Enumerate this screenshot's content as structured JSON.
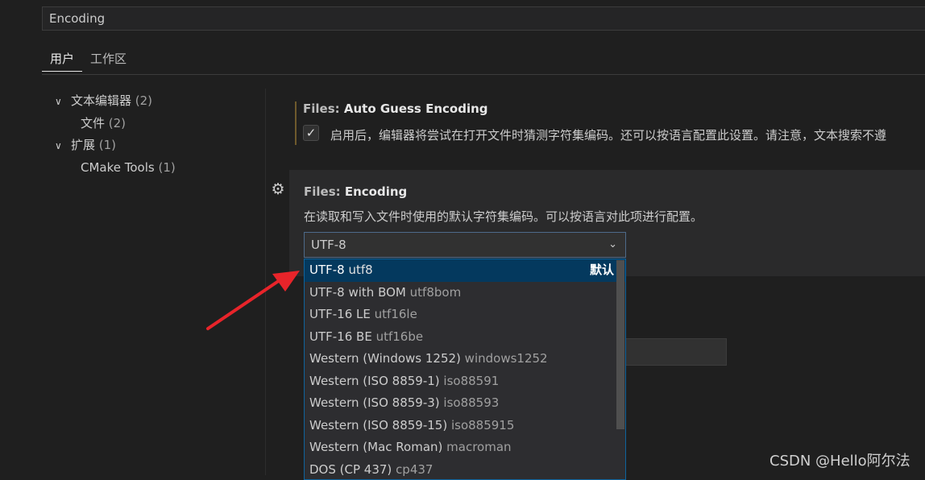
{
  "search": {
    "value": "Encoding"
  },
  "tabs": [
    {
      "label": "用户"
    },
    {
      "label": "工作区"
    }
  ],
  "toc": [
    {
      "label": "文本编辑器",
      "count": " (2)",
      "chevron": "∨"
    },
    {
      "label": "文件",
      "count": " (2)"
    },
    {
      "label": "扩展",
      "count": " (1)",
      "chevron": "∨"
    },
    {
      "label": "CMake Tools",
      "count": " (1)"
    }
  ],
  "setting_auto_guess": {
    "category": "Files: ",
    "name": "Auto Guess Encoding",
    "checked": true,
    "description": "启用后，编辑器将尝试在打开文件时猜测字符集编码。还可以按语言配置此设置。请注意，文本搜索不遵"
  },
  "setting_encoding": {
    "category": "Files: ",
    "name": "Encoding",
    "description": "在读取和写入文件时使用的默认字符集编码。可以按语言对此项进行配置。",
    "selected": "UTF-8",
    "chevron": "⌄"
  },
  "dropdown_options": [
    {
      "label": "UTF-8",
      "id": "utf8",
      "default": "默认",
      "selected": true
    },
    {
      "label": "UTF-8 with BOM",
      "id": "utf8bom"
    },
    {
      "label": "UTF-16 LE",
      "id": "utf16le"
    },
    {
      "label": "UTF-16 BE",
      "id": "utf16be"
    },
    {
      "label": "Western (Windows 1252)",
      "id": "windows1252"
    },
    {
      "label": "Western (ISO 8859-1)",
      "id": "iso88591"
    },
    {
      "label": "Western (ISO 8859-3)",
      "id": "iso88593"
    },
    {
      "label": "Western (ISO 8859-15)",
      "id": "iso885915"
    },
    {
      "label": "Western (Mac Roman)",
      "id": "macroman"
    },
    {
      "label": "DOS (CP 437)",
      "id": "cp437"
    }
  ],
  "icons": {
    "gear": "⚙",
    "check": "✓"
  },
  "colors": {
    "arrow": "#e8242a",
    "selection": "#04395e",
    "focus_border": "#0e639c"
  },
  "watermark": "CSDN @Hello阿尔法"
}
